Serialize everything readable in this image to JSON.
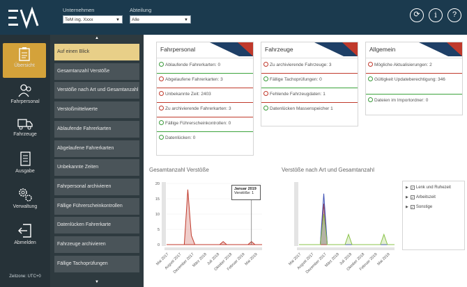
{
  "filters": {
    "unternehmen_label": "Unternehmen",
    "unternehmen_value": "TeM ing. Xxxx",
    "abteilung_label": "Abteilung",
    "abteilung_value": "Alle"
  },
  "top_icons": [
    "sync-icon",
    "info-icon",
    "help-icon"
  ],
  "nav": {
    "items": [
      {
        "label": "Übersicht",
        "icon": "overview-icon",
        "active": true
      },
      {
        "label": "Fahrpersonal",
        "icon": "people-icon",
        "active": false
      },
      {
        "label": "Fahrzeuge",
        "icon": "truck-icon",
        "active": false
      },
      {
        "label": "Ausgabe",
        "icon": "document-icon",
        "active": false
      },
      {
        "label": "Verwaltung",
        "icon": "gears-icon",
        "active": false
      },
      {
        "label": "Abmelden",
        "icon": "logout-icon",
        "active": false
      }
    ],
    "zeitzone": "Zeitzone: UTC+0"
  },
  "submenu": {
    "items": [
      "Auf einen Blick",
      "Gesamtanzahl Verstöße",
      "Verstöße nach Art und Gesamtanzahl",
      "Verstoßmittelwerte",
      "Ablaufende Fahrerkarten",
      "Abgelaufene Fahrerkarten",
      "Unbekannte Zeiten",
      "Fahrpersonal archivieren",
      "Fällige Führerscheinkontrollen",
      "Datenlücken Fahrerkarte",
      "Fahrzeuge archivieren",
      "Fällige Tachoprüfungen"
    ]
  },
  "cards": [
    {
      "title": "Fahrpersonal",
      "rows": [
        {
          "text": "Ablaufende Fahrerkarten:  0",
          "status": "ok"
        },
        {
          "text": "Abgelaufene Fahrerkarten:  3",
          "status": "err"
        },
        {
          "text": "Unbekannte Zeit:  2403",
          "status": "err"
        },
        {
          "text": "Zu archivierende Fahrerkarten:  3",
          "status": "err"
        },
        {
          "text": "Fällige Führerscheinkontrollen:  0",
          "status": "ok"
        },
        {
          "text": "Datenlücken:  0",
          "status": "ok"
        }
      ]
    },
    {
      "title": "Fahrzeuge",
      "rows": [
        {
          "text": "Zu archivierende Fahrzeuge:  3",
          "status": "err"
        },
        {
          "text": "Fällige Tachoprüfungen:  0",
          "status": "ok"
        },
        {
          "text": "Fehlende Fahrzeugdaten:  1",
          "status": "err"
        },
        {
          "text": "Datenlücken Massenspeicher  1",
          "status": "ok"
        }
      ]
    },
    {
      "title": "Allgemein",
      "rows": [
        {
          "text": "Mögliche Aktualisierungen:  2",
          "status": "err"
        },
        {
          "text": "Gültigkeit Updateberechtigung:  346",
          "status": "ok"
        },
        {
          "text": "Dateien im Importordner:  0",
          "status": "ok"
        }
      ]
    }
  ],
  "colors": {
    "ok": "#3aa33a",
    "err": "#c0392b",
    "accent": "#d4a23a",
    "topbar": "#1b3a4e"
  },
  "chart_data": [
    {
      "type": "area",
      "title": "Gesamtanzahl Verstöße",
      "ylim": [
        0,
        20
      ],
      "yticks": [
        0,
        5,
        10,
        15,
        20
      ],
      "categories": [
        "Mai 2017",
        "August 2017",
        "Dezember 2017",
        "März 2018",
        "Juli 2018",
        "Oktober 2018",
        "Februar 2019",
        "Mai 2019"
      ],
      "series": [
        {
          "values": [
            0,
            0,
            0,
            0,
            0,
            0,
            18,
            3,
            0,
            0,
            0,
            0,
            0,
            0,
            0,
            0,
            1,
            0,
            0,
            0,
            0,
            0,
            0,
            0,
            1,
            0,
            0,
            0
          ],
          "color": "#c0392b"
        }
      ],
      "tooltip": {
        "title": "Januar 2019",
        "text": "Verstöße: 1"
      }
    },
    {
      "type": "area",
      "title": "Verstöße nach Art und Gesamtanzahl",
      "categories": [
        "Mai 2017",
        "August 2017",
        "Dezember 2017",
        "März 2018",
        "Juli 2018",
        "Oktober 2018",
        "Februar 2019",
        "Mai 2019"
      ],
      "legend": [
        "Lenk und Ruhezeit",
        "Arbeitszeit",
        "Sonstige"
      ],
      "series": [
        {
          "name": "Lenk und Ruhezeit",
          "color": "#c0392b",
          "values": [
            0,
            0,
            0,
            0,
            0,
            0,
            0,
            4,
            0,
            0,
            0,
            0,
            0,
            0,
            0,
            0,
            0,
            0,
            0,
            0,
            0,
            0,
            0,
            0,
            0,
            0,
            0,
            0
          ]
        },
        {
          "name": "Arbeitszeit",
          "color": "#3f51b5",
          "values": [
            0,
            0,
            0,
            0,
            0,
            0,
            0,
            5,
            0,
            0,
            0,
            0,
            0,
            0,
            0,
            0,
            0,
            0,
            0,
            0,
            0,
            0,
            0,
            0,
            0,
            0,
            0,
            0
          ]
        },
        {
          "name": "Sonstige",
          "color": "#8bc34a",
          "values": [
            0,
            0,
            0,
            0,
            0,
            0,
            0,
            3,
            0,
            0,
            0,
            0,
            0,
            0,
            1,
            0,
            0,
            0,
            0,
            0,
            0,
            0,
            0,
            0,
            1,
            0,
            0,
            0
          ]
        }
      ]
    }
  ]
}
